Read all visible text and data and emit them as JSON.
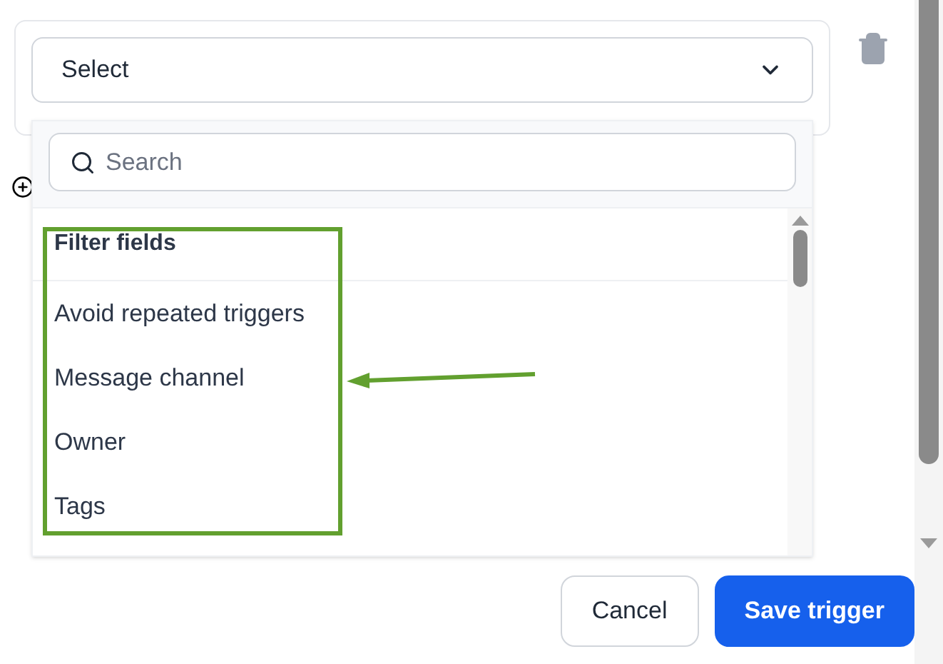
{
  "select": {
    "placeholder": "Select"
  },
  "dropdown": {
    "search": {
      "placeholder": "Search"
    },
    "group_label": "Filter fields",
    "items": [
      {
        "label": "Avoid repeated triggers"
      },
      {
        "label": "Message channel"
      },
      {
        "label": "Owner"
      },
      {
        "label": "Tags"
      }
    ]
  },
  "buttons": [
    {
      "label": "Cancel",
      "kind": "secondary"
    },
    {
      "label": "Save trigger",
      "kind": "primary"
    }
  ]
}
